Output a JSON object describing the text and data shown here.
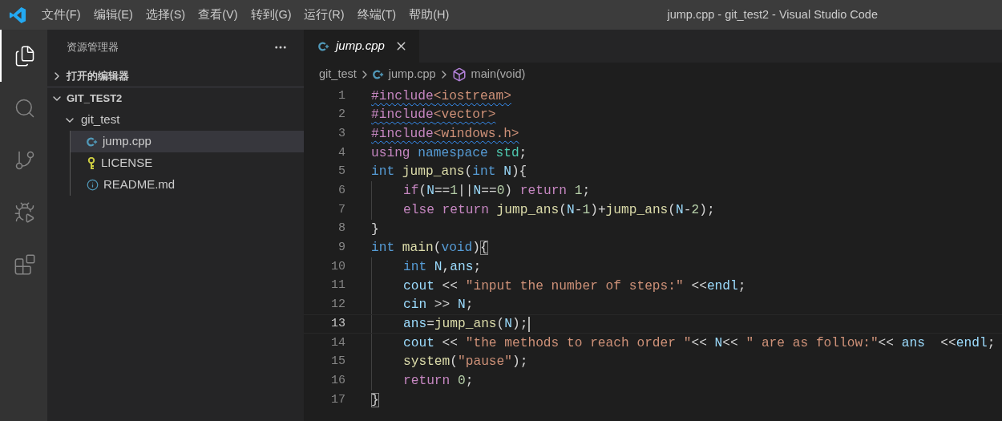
{
  "window": {
    "title": "jump.cpp - git_test2 - Visual Studio Code"
  },
  "menu": [
    "文件(F)",
    "编辑(E)",
    "选择(S)",
    "查看(V)",
    "转到(G)",
    "运行(R)",
    "终端(T)",
    "帮助(H)"
  ],
  "activity_bar": [
    {
      "kind": "explorer",
      "selected": true
    },
    {
      "kind": "search",
      "selected": false
    },
    {
      "kind": "source-control",
      "selected": false
    },
    {
      "kind": "run-debug",
      "selected": false
    },
    {
      "kind": "extensions",
      "selected": false
    }
  ],
  "sidebar": {
    "title": "资源管理器",
    "sections": [
      {
        "label": "打开的编辑器",
        "expanded": false
      },
      {
        "label": "GIT_TEST2",
        "expanded": true,
        "tree": [
          {
            "label": "git_test",
            "kind": "folder",
            "expanded": true,
            "children": [
              {
                "label": "jump.cpp",
                "kind": "cpp",
                "selected": true
              },
              {
                "label": "LICENSE",
                "kind": "license",
                "selected": false
              },
              {
                "label": "README.md",
                "kind": "info",
                "selected": false
              }
            ]
          }
        ]
      }
    ]
  },
  "tabs": [
    {
      "label": "jump.cpp",
      "kind": "cpp",
      "selected": true,
      "preview": true
    }
  ],
  "breadcrumbs": [
    {
      "label": "git_test",
      "kind": "folder"
    },
    {
      "label": "jump.cpp",
      "kind": "cpp"
    },
    {
      "label": "main(void)",
      "kind": "symbol"
    }
  ],
  "editor": {
    "lines": [
      {
        "number": "1",
        "indented": false,
        "squiggle": true,
        "current": false,
        "tokens": [
          {
            "kind": "keyword",
            "text": "#include"
          },
          {
            "kind": "string",
            "text": "<iostream>"
          }
        ]
      },
      {
        "number": "2",
        "indented": false,
        "squiggle": true,
        "current": false,
        "tokens": [
          {
            "kind": "keyword",
            "text": "#include"
          },
          {
            "kind": "string",
            "text": "<vector>"
          }
        ]
      },
      {
        "number": "3",
        "indented": false,
        "squiggle": true,
        "current": false,
        "tokens": [
          {
            "kind": "keyword",
            "text": "#include"
          },
          {
            "kind": "string",
            "text": "<windows.h>"
          }
        ]
      },
      {
        "number": "4",
        "indented": false,
        "squiggle": false,
        "current": false,
        "tokens": [
          {
            "kind": "keyword",
            "text": "using "
          },
          {
            "kind": "type",
            "text": "namespace "
          },
          {
            "kind": "namespace",
            "text": "std"
          },
          {
            "kind": "plain",
            "text": ";"
          }
        ]
      },
      {
        "number": "5",
        "indented": false,
        "squiggle": false,
        "current": false,
        "tokens": [
          {
            "kind": "type",
            "text": "int "
          },
          {
            "kind": "function",
            "text": "jump_ans"
          },
          {
            "kind": "plain",
            "text": "("
          },
          {
            "kind": "type",
            "text": "int "
          },
          {
            "kind": "variable",
            "text": "N"
          },
          {
            "kind": "plain",
            "text": "){"
          }
        ]
      },
      {
        "number": "6",
        "indented": true,
        "squiggle": false,
        "current": false,
        "tokens": [
          {
            "kind": "keyword",
            "text": "if"
          },
          {
            "kind": "plain",
            "text": "("
          },
          {
            "kind": "variable",
            "text": "N"
          },
          {
            "kind": "plain",
            "text": "=="
          },
          {
            "kind": "number",
            "text": "1"
          },
          {
            "kind": "plain",
            "text": "||"
          },
          {
            "kind": "variable",
            "text": "N"
          },
          {
            "kind": "plain",
            "text": "=="
          },
          {
            "kind": "number",
            "text": "0"
          },
          {
            "kind": "plain",
            "text": ") "
          },
          {
            "kind": "keyword",
            "text": "return "
          },
          {
            "kind": "number",
            "text": "1"
          },
          {
            "kind": "plain",
            "text": ";"
          }
        ]
      },
      {
        "number": "7",
        "indented": true,
        "squiggle": false,
        "current": false,
        "tokens": [
          {
            "kind": "keyword",
            "text": "else return "
          },
          {
            "kind": "function",
            "text": "jump_ans"
          },
          {
            "kind": "plain",
            "text": "("
          },
          {
            "kind": "variable",
            "text": "N"
          },
          {
            "kind": "plain",
            "text": "-"
          },
          {
            "kind": "number",
            "text": "1"
          },
          {
            "kind": "plain",
            "text": ")+"
          },
          {
            "kind": "function",
            "text": "jump_ans"
          },
          {
            "kind": "plain",
            "text": "("
          },
          {
            "kind": "variable",
            "text": "N"
          },
          {
            "kind": "plain",
            "text": "-"
          },
          {
            "kind": "number",
            "text": "2"
          },
          {
            "kind": "plain",
            "text": ");"
          }
        ]
      },
      {
        "number": "8",
        "indented": false,
        "squiggle": false,
        "current": false,
        "tokens": [
          {
            "kind": "plain",
            "text": "}"
          }
        ]
      },
      {
        "number": "9",
        "indented": false,
        "squiggle": false,
        "current": false,
        "tokens": [
          {
            "kind": "type",
            "text": "int "
          },
          {
            "kind": "function",
            "text": "main"
          },
          {
            "kind": "plain",
            "text": "("
          },
          {
            "kind": "type",
            "text": "void"
          },
          {
            "kind": "plain",
            "text": ")"
          },
          {
            "kind": "bracket-match",
            "text": "{"
          }
        ]
      },
      {
        "number": "10",
        "indented": true,
        "squiggle": false,
        "current": false,
        "tokens": [
          {
            "kind": "type",
            "text": "int "
          },
          {
            "kind": "variable",
            "text": "N"
          },
          {
            "kind": "plain",
            "text": ","
          },
          {
            "kind": "variable",
            "text": "ans"
          },
          {
            "kind": "plain",
            "text": ";"
          }
        ]
      },
      {
        "number": "11",
        "indented": true,
        "squiggle": false,
        "current": false,
        "tokens": [
          {
            "kind": "variable",
            "text": "cout"
          },
          {
            "kind": "plain",
            "text": " << "
          },
          {
            "kind": "string",
            "text": "\"input the number of steps:\""
          },
          {
            "kind": "plain",
            "text": " <<"
          },
          {
            "kind": "variable",
            "text": "endl"
          },
          {
            "kind": "plain",
            "text": ";"
          }
        ]
      },
      {
        "number": "12",
        "indented": true,
        "squiggle": false,
        "current": false,
        "tokens": [
          {
            "kind": "variable",
            "text": "cin"
          },
          {
            "kind": "plain",
            "text": " >> "
          },
          {
            "kind": "variable",
            "text": "N"
          },
          {
            "kind": "plain",
            "text": ";"
          }
        ]
      },
      {
        "number": "13",
        "indented": true,
        "squiggle": false,
        "current": true,
        "tokens": [
          {
            "kind": "variable",
            "text": "ans"
          },
          {
            "kind": "plain",
            "text": "="
          },
          {
            "kind": "function",
            "text": "jump_ans"
          },
          {
            "kind": "plain",
            "text": "("
          },
          {
            "kind": "variable",
            "text": "N"
          },
          {
            "kind": "plain",
            "text": ");"
          }
        ]
      },
      {
        "number": "14",
        "indented": true,
        "squiggle": false,
        "current": false,
        "tokens": [
          {
            "kind": "variable",
            "text": "cout"
          },
          {
            "kind": "plain",
            "text": " << "
          },
          {
            "kind": "string",
            "text": "\"the methods to reach order \""
          },
          {
            "kind": "plain",
            "text": "<< "
          },
          {
            "kind": "variable",
            "text": "N"
          },
          {
            "kind": "plain",
            "text": "<< "
          },
          {
            "kind": "string",
            "text": "\" are as follow:\""
          },
          {
            "kind": "plain",
            "text": "<< "
          },
          {
            "kind": "variable",
            "text": "ans"
          },
          {
            "kind": "plain",
            "text": "  <<"
          },
          {
            "kind": "variable",
            "text": "endl"
          },
          {
            "kind": "plain",
            "text": ";"
          }
        ]
      },
      {
        "number": "15",
        "indented": true,
        "squiggle": false,
        "current": false,
        "tokens": [
          {
            "kind": "function",
            "text": "system"
          },
          {
            "kind": "plain",
            "text": "("
          },
          {
            "kind": "string",
            "text": "\"pause\""
          },
          {
            "kind": "plain",
            "text": ");"
          }
        ]
      },
      {
        "number": "16",
        "indented": true,
        "squiggle": false,
        "current": false,
        "tokens": [
          {
            "kind": "keyword",
            "text": "return "
          },
          {
            "kind": "number",
            "text": "0"
          },
          {
            "kind": "plain",
            "text": ";"
          }
        ]
      },
      {
        "number": "17",
        "indented": false,
        "squiggle": false,
        "current": false,
        "tokens": [
          {
            "kind": "bracket-match",
            "text": "}"
          }
        ]
      }
    ]
  }
}
